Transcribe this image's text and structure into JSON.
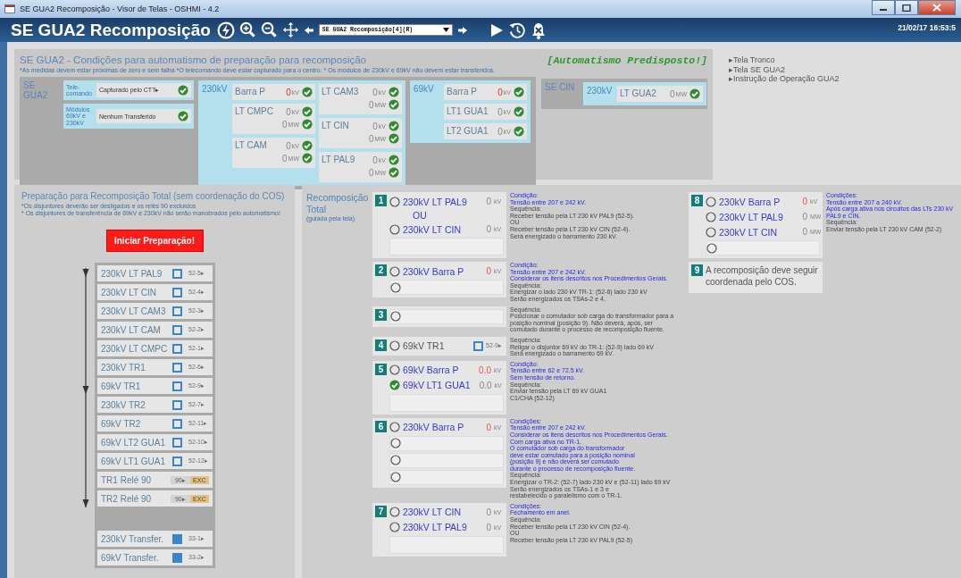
{
  "window": {
    "title": "SE GUA2 Recomposição - Visor de Telas - OSHMI - 4.2"
  },
  "toolbar": {
    "title": "SE GUA2 Recomposição",
    "screen": "SE GUA2 Recomposição[4](R)",
    "datetime": "21/02/17 16:53:5"
  },
  "conditions": {
    "title": "SE GUA2 - Condições para automatismo de preparação para recomposição",
    "note": "*As medidas devem estar próximas de zero e sem falha  *O telecomando deve estar capturado para o centro. * Os módulos de 230kV e 69kV não devem estar transferidos.",
    "status": "[Automatismo Predisposto!]",
    "substations": [
      {
        "name": "SE GUA2",
        "checks": [
          {
            "label": "Tele-comando",
            "value": "Capturado pelo CTT▸",
            "ok": true
          },
          {
            "label": "Módulos 69kV e 230kV",
            "value": "Nenhum Transferido",
            "ok": true
          }
        ],
        "levels": [
          {
            "name": "230kV",
            "columns": [
              [
                {
                  "name": "Barra P",
                  "readings": [
                    {
                      "value": "0",
                      "unit": "kV",
                      "alarm": true,
                      "ok": true
                    }
                  ]
                },
                {
                  "name": "LT CMPC",
                  "readings": [
                    {
                      "value": "0",
                      "unit": "kV",
                      "alarm": false,
                      "ok": true
                    },
                    {
                      "value": "0",
                      "unit": "MW",
                      "alarm": false,
                      "ok": true
                    }
                  ]
                },
                {
                  "name": "LT CAM",
                  "readings": [
                    {
                      "value": "0",
                      "unit": "kV",
                      "alarm": false,
                      "ok": true
                    },
                    {
                      "value": "0",
                      "unit": "MW",
                      "alarm": false,
                      "ok": true
                    }
                  ]
                }
              ],
              [
                {
                  "name": "LT CAM3",
                  "readings": [
                    {
                      "value": "0",
                      "unit": "kV",
                      "alarm": false,
                      "ok": true
                    },
                    {
                      "value": "0",
                      "unit": "MW",
                      "alarm": false,
                      "ok": true
                    }
                  ]
                },
                {
                  "name": "LT CIN",
                  "readings": [
                    {
                      "value": "0",
                      "unit": "kV",
                      "alarm": false,
                      "ok": true
                    },
                    {
                      "value": "0",
                      "unit": "MW",
                      "alarm": false,
                      "ok": true
                    }
                  ]
                },
                {
                  "name": "LT PAL9",
                  "readings": [
                    {
                      "value": "0",
                      "unit": "kV",
                      "alarm": false,
                      "ok": true
                    },
                    {
                      "value": "0",
                      "unit": "MW",
                      "alarm": false,
                      "ok": true
                    }
                  ]
                }
              ]
            ]
          },
          {
            "name": "69kV",
            "columns": [
              [
                {
                  "name": "Barra P",
                  "readings": [
                    {
                      "value": "0",
                      "unit": "kV",
                      "alarm": true,
                      "ok": true
                    }
                  ]
                },
                {
                  "name": "LT1 GUA1",
                  "readings": [
                    {
                      "value": "0",
                      "unit": "kV",
                      "alarm": false,
                      "ok": true
                    }
                  ]
                },
                {
                  "name": "LT2 GUA1",
                  "readings": [
                    {
                      "value": "0",
                      "unit": "kV",
                      "alarm": false,
                      "ok": true
                    }
                  ]
                }
              ]
            ]
          }
        ]
      },
      {
        "name": "SE CIN",
        "levels": [
          {
            "name": "230kV",
            "columns": [
              [
                {
                  "name": "LT GUA2",
                  "readings": [
                    {
                      "value": "0",
                      "unit": "MW",
                      "alarm": false,
                      "ok": true
                    }
                  ]
                }
              ]
            ]
          }
        ]
      }
    ]
  },
  "links": [
    "▸Tela Tronco",
    "▸Tela SE GUA2",
    "▸Instrução de Operação GUA2"
  ],
  "prep": {
    "title": "Preparação para Recomposição Total (sem coordenação do COS)",
    "notes": [
      "*Os disjuntores deverão ser desligados e os relés 90 excluídos",
      "* Os disjuntores de transferência de 69kV e 230kV não serão manobrados pelo automatismo!"
    ],
    "button": "Iniciar Preparação!",
    "sequence": [
      {
        "kind": "breaker",
        "label": "230kV LT PAL9",
        "checked": false,
        "tag": "52-5▸"
      },
      {
        "kind": "breaker",
        "label": "230kV LT CIN",
        "checked": false,
        "tag": "52-4▸"
      },
      {
        "kind": "breaker",
        "label": "230kV LT CAM3",
        "checked": false,
        "tag": "52-3▸"
      },
      {
        "kind": "breaker",
        "label": "230kV LT CAM",
        "checked": false,
        "tag": "52-2▸"
      },
      {
        "kind": "breaker",
        "label": "230kV LT CMPC",
        "checked": false,
        "tag": "52-1▸"
      },
      {
        "kind": "breaker",
        "label": "230kV TR1",
        "checked": false,
        "tag": "52-6▸"
      },
      {
        "kind": "breaker",
        "label": "69kV TR1",
        "checked": false,
        "tag": "52-9▸"
      },
      {
        "kind": "breaker",
        "label": "230kV TR2",
        "checked": false,
        "tag": "52-7▸"
      },
      {
        "kind": "breaker",
        "label": "69kV TR2",
        "checked": false,
        "tag": "52-11▸"
      },
      {
        "kind": "breaker",
        "label": "69kV LT2 GUA1",
        "checked": false,
        "tag": "52-10▸"
      },
      {
        "kind": "breaker",
        "label": "69kV LT1 GUA1",
        "checked": false,
        "tag": "52-12▸"
      },
      {
        "kind": "relay",
        "label": "TR1 Relé 90",
        "tag": "90▸",
        "state": "EXC"
      },
      {
        "kind": "relay",
        "label": "TR2 Relé 90",
        "tag": "90▸",
        "state": "EXC"
      }
    ],
    "transfers": [
      {
        "kind": "breaker",
        "label": "230kV Transfer.",
        "checked": true,
        "tag": "33-1▸"
      },
      {
        "kind": "breaker",
        "label": "69kV Transfer.",
        "checked": true,
        "tag": "33-2▸"
      }
    ]
  },
  "recomp": {
    "title": "Recomposição Total",
    "subtitle": "(guiada pela tela)",
    "columns": [
      [
        {
          "number": "1",
          "rows": [
            {
              "kind": "measure",
              "label": "230kV LT PAL9",
              "value": "0",
              "unit": "kV",
              "alarm": false,
              "selected": false
            },
            {
              "kind": "or",
              "label": "OU"
            },
            {
              "kind": "measure",
              "label": "230kV LT CIN",
              "value": "0",
              "unit": "kV",
              "alarm": false,
              "selected": false
            },
            {
              "kind": "blank"
            }
          ],
          "notes": [
            {
              "kind": "condition",
              "text": "Condição:"
            },
            {
              "kind": "condition",
              "text": "Tensão entre 207 e 242 kV."
            },
            {
              "kind": "sequence",
              "text": "Sequência:"
            },
            {
              "kind": "sequence",
              "text": "Receber tensão pela LT 230 kV PAL9 (52-5)."
            },
            {
              "kind": "sequence",
              "text": "OU"
            },
            {
              "kind": "sequence",
              "text": "Receber tensão pela LT 230 kV CIN (52-4)."
            },
            {
              "kind": "sequence",
              "text": "Será energizado o barramento 230 kV."
            }
          ]
        },
        {
          "number": "2",
          "rows": [
            {
              "kind": "measure",
              "label": "230kV Barra P",
              "value": "0",
              "unit": "kV",
              "alarm": true,
              "selected": false
            },
            {
              "kind": "empty",
              "selected": false
            }
          ],
          "notes": [
            {
              "kind": "condition",
              "text": "Condição:"
            },
            {
              "kind": "condition",
              "text": "Tensão entre 207 e 242 kV."
            },
            {
              "kind": "condition",
              "text": "Considerar os itens descritos nos Procedimentos Gerais."
            },
            {
              "kind": "sequence",
              "text": "Sequência:"
            },
            {
              "kind": "sequence",
              "text": "Energizar o lado 230 kV TR-1: (52-6) lado 230 kV"
            },
            {
              "kind": "sequence",
              "text": "Serão energizados os TSAs-2 e 4."
            }
          ]
        },
        {
          "number": "3",
          "rows": [
            {
              "kind": "empty",
              "selected": false
            }
          ],
          "notes": [
            {
              "kind": "sequence",
              "text": "Sequência:"
            },
            {
              "kind": "sequence",
              "text": "Posicionar o comutador sob carga do transformador para a posição nominal (posição 9). Não deverá, após, ser comutado durante o processo de recomposição fluente."
            }
          ]
        },
        {
          "number": "4",
          "rows": [
            {
              "kind": "breaker",
              "label": "69kV TR1",
              "selected": false,
              "checked": false,
              "tag": "52-9▸"
            }
          ],
          "notes": [
            {
              "kind": "sequence",
              "text": "Sequência:"
            },
            {
              "kind": "sequence",
              "text": "Religar o disjuntor 69 kV do TR-1: (52-9) lado 69 kV"
            },
            {
              "kind": "sequence",
              "text": "Será energizado o barramento 69 kV."
            }
          ]
        },
        {
          "number": "5",
          "rows": [
            {
              "kind": "measure",
              "label": "69kV Barra P",
              "value": "0.0",
              "unit": "kV",
              "alarm": true,
              "selected": false
            },
            {
              "kind": "measure",
              "label": "69kV LT1 GUA1",
              "value": "0.0",
              "unit": "kV",
              "alarm": false,
              "selected": true
            },
            {
              "kind": "blank"
            }
          ],
          "notes": [
            {
              "kind": "condition",
              "text": "Condição:"
            },
            {
              "kind": "condition",
              "text": "Tensão entre 62 e 72.5 kV."
            },
            {
              "kind": "condition",
              "text": "Sem tensão de retorno."
            },
            {
              "kind": "sequence",
              "text": "Sequência:"
            },
            {
              "kind": "sequence",
              "text": "Enviar tensão pela LT 69 kV GUA1"
            },
            {
              "kind": "sequence",
              "text": "C1/CHA (52-12)"
            }
          ]
        },
        {
          "number": "6",
          "rows": [
            {
              "kind": "measure",
              "label": "230kV Barra P",
              "value": "0",
              "unit": "kV",
              "alarm": true,
              "selected": false
            },
            {
              "kind": "empty",
              "selected": false
            },
            {
              "kind": "empty",
              "selected": false
            },
            {
              "kind": "empty",
              "selected": false
            }
          ],
          "notes": [
            {
              "kind": "condition",
              "text": "Condições:"
            },
            {
              "kind": "condition",
              "text": "Tensão entre 207 e 242 kV."
            },
            {
              "kind": "condition",
              "text": "Considerar os itens descritos nos Procedimentos Gerais."
            },
            {
              "kind": "condition",
              "text": "Com carga ativa no TR-1."
            },
            {
              "kind": "condition",
              "text": "O comutador sob carga do transformador"
            },
            {
              "kind": "condition",
              "text": "deve estar comutado para a posição nominal"
            },
            {
              "kind": "condition",
              "text": "(posição 9) e não deverá ser comutado"
            },
            {
              "kind": "condition",
              "text": "durante o processo de recomposição fluente."
            },
            {
              "kind": "sequence",
              "text": "Sequência:"
            },
            {
              "kind": "sequence",
              "text": "Energizar o TR-2: (52-7) lado 230 kV e (52-11) lado 69 kV"
            },
            {
              "kind": "sequence",
              "text": "Serão energizados os TSAs-1 e 3 e"
            },
            {
              "kind": "sequence",
              "text": "restabelecido o paralelismo com o TR-1."
            }
          ]
        },
        {
          "number": "7",
          "rows": [
            {
              "kind": "measure",
              "label": "230kV LT CIN",
              "value": "0",
              "unit": "kV",
              "alarm": false,
              "selected": false
            },
            {
              "kind": "measure",
              "label": "230kV LT PAL9",
              "value": "0",
              "unit": "kV",
              "alarm": false,
              "selected": false
            },
            {
              "kind": "blank"
            }
          ],
          "notes": [
            {
              "kind": "condition",
              "text": "Condições:"
            },
            {
              "kind": "condition",
              "text": "Fechamento em anel."
            },
            {
              "kind": "sequence",
              "text": "Sequência:"
            },
            {
              "kind": "sequence",
              "text": "Receber tensão pela LT 230 kV CIN (52-4)."
            },
            {
              "kind": "sequence",
              "text": "OU"
            },
            {
              "kind": "sequence",
              "text": "Receber tensão pela LT 230 kV PAL9 (52-5)"
            }
          ]
        }
      ],
      [
        {
          "number": "8",
          "rows": [
            {
              "kind": "measure",
              "label": "230kV Barra P",
              "value": "0",
              "unit": "kV",
              "alarm": true,
              "selected": false
            },
            {
              "kind": "measure",
              "label": "230kV LT PAL9",
              "value": "0",
              "unit": "MW",
              "alarm": false,
              "selected": false
            },
            {
              "kind": "measure",
              "label": "230kV LT CIN",
              "value": "0",
              "unit": "MW",
              "alarm": false,
              "selected": false
            },
            {
              "kind": "empty",
              "selected": false
            }
          ],
          "notes": [
            {
              "kind": "condition",
              "text": "Condições:"
            },
            {
              "kind": "condition",
              "text": "Tensão entre 207 a 240 kV."
            },
            {
              "kind": "condition",
              "text": "Após carga ativa nos circuitos das LTs 230 kV PAL9 e CIN."
            },
            {
              "kind": "sequence",
              "text": "Sequência:"
            },
            {
              "kind": "sequence",
              "text": "Enviar tensão pela LT 230 kV CAM (52-2)"
            }
          ]
        },
        {
          "number": "9",
          "text": "A recomposição deve seguir coordenada pelo COS."
        }
      ]
    ]
  }
}
